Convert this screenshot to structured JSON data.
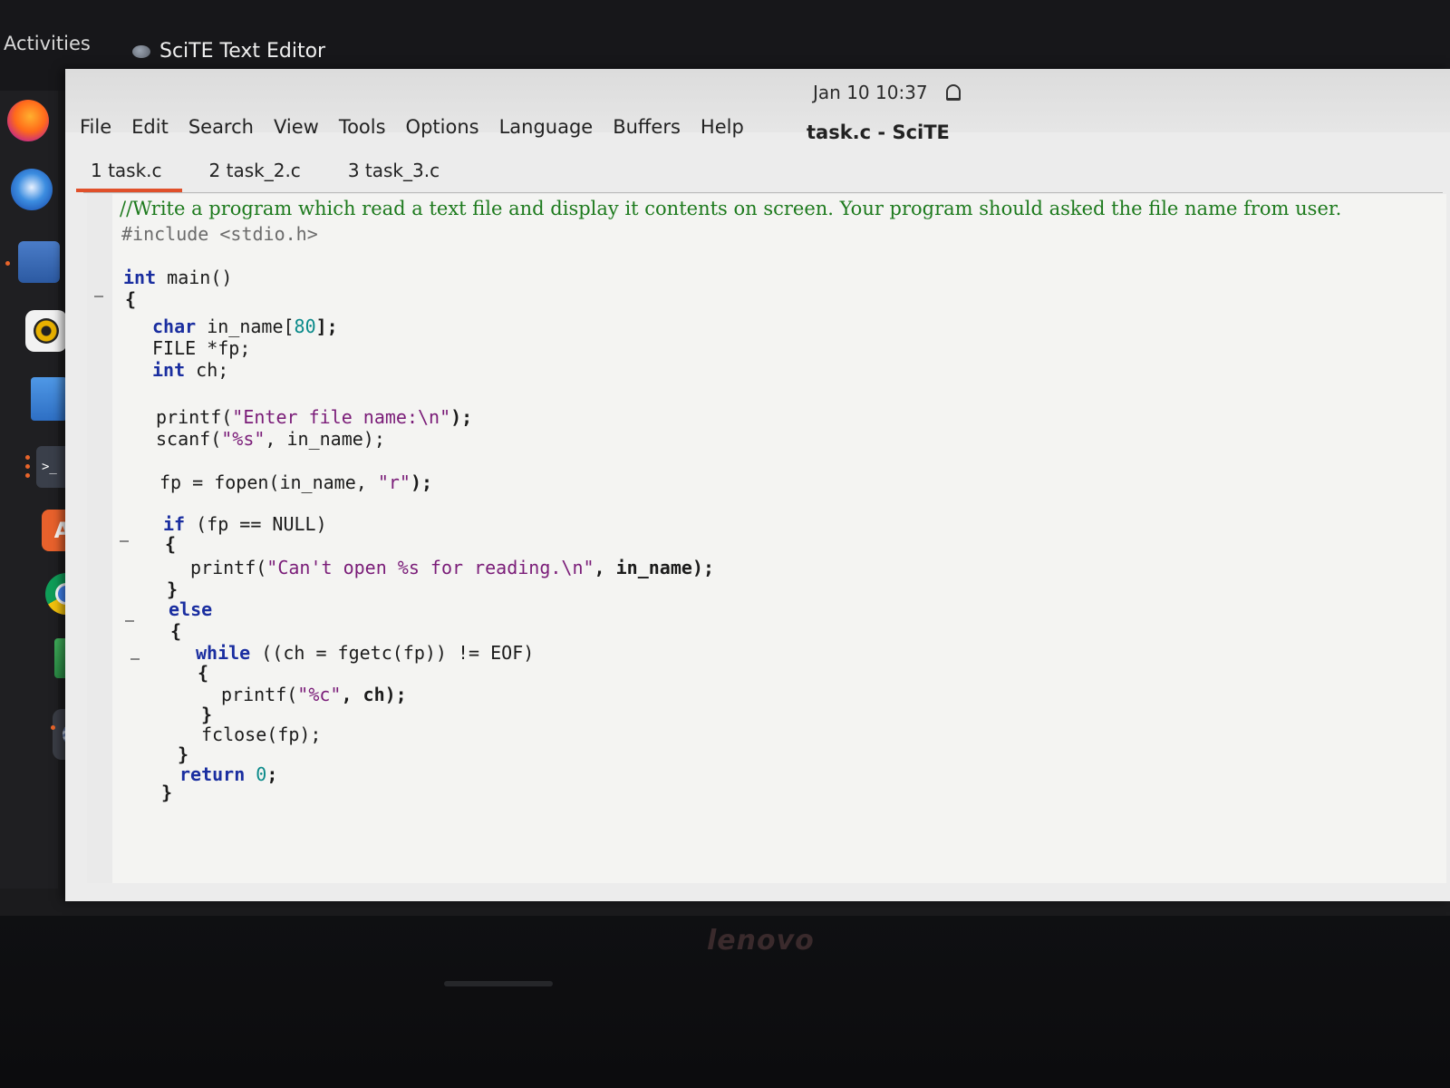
{
  "topbar": {
    "activities_label": "Activities",
    "app_name": "SciTE Text Editor"
  },
  "clock": {
    "date_time": "Jan 10  10:37"
  },
  "window": {
    "title": "task.c - SciTE"
  },
  "menu": {
    "items": [
      "File",
      "Edit",
      "Search",
      "View",
      "Tools",
      "Options",
      "Language",
      "Buffers",
      "Help"
    ]
  },
  "tabs": [
    {
      "label": "1 task.c",
      "active": true
    },
    {
      "label": "2 task_2.c",
      "active": false
    },
    {
      "label": "3 task_3.c",
      "active": false
    }
  ],
  "dock": {
    "icons": [
      "firefox-icon",
      "thunderbird-icon",
      "files-icon",
      "rhythmbox-icon",
      "writer-icon",
      "terminal-icon",
      "software-icon",
      "chrome-icon",
      "calc-icon",
      "scite-icon",
      "trash-icon",
      "app-grid-icon"
    ]
  },
  "code": {
    "comment": "//Write a program which read a text file and display it contents on screen. Your program should asked the file name from user.",
    "include": "#include <stdio.h>",
    "lines": {
      "main_kw": "int",
      "main_sig": " main()",
      "open_brace": "{",
      "char_kw": "char",
      "char_decl": " in_name[",
      "char_size": "80",
      "char_end": "];",
      "file_decl": "FILE *fp;",
      "int_kw": "int",
      "int_decl": " ch;",
      "printf1_a": "printf(",
      "printf1_str": "\"Enter file name:\\n\"",
      "printf1_b": ");",
      "scanf_a": "scanf(",
      "scanf_str": "\"%s\"",
      "scanf_b": ", in_name);",
      "fopen_a": "fp = fopen(in_name, ",
      "fopen_str": "\"r\"",
      "fopen_b": ");",
      "if_kw": "if",
      "if_cond": " (fp == NULL)",
      "if_open": "{",
      "printf2_a": "printf(",
      "printf2_str": "\"Can't open %s for reading.\\n\"",
      "printf2_b": ", in_name);",
      "if_close": "}",
      "else_kw": "else",
      "else_open": "{",
      "while_kw": "while",
      "while_cond": " ((ch = fgetc(fp)) != EOF)",
      "while_open": "{",
      "printf3_a": "printf(",
      "printf3_str": "\"%c\"",
      "printf3_b": ", ch);",
      "while_close": "}",
      "fclose": "fclose(fp);",
      "else_close": "}",
      "return_kw": "return",
      "return_val": "0",
      "return_end": ";",
      "main_close": "}"
    }
  },
  "laptop": {
    "brand": "lenovo"
  },
  "colors": {
    "comment": "#1d7a1d",
    "keyword": "#1a2ea0",
    "string": "#7a1c78",
    "number": "#0a8a8a",
    "active_tab": "#e0502a"
  }
}
